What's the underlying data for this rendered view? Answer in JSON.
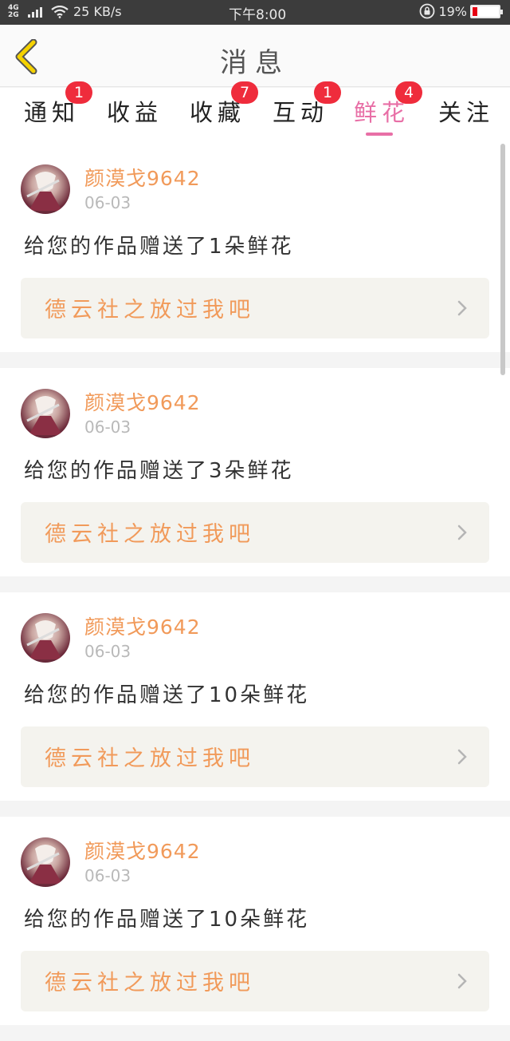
{
  "status_bar": {
    "network": "4G",
    "network2": "2G",
    "speed": "25 KB/s",
    "time": "下午8:00",
    "battery": "19%",
    "battery_color": "#e60012"
  },
  "nav": {
    "back_icon": "chevron-left-icon",
    "title": "消息"
  },
  "tabs": [
    {
      "label": "通知",
      "badge": "1"
    },
    {
      "label": "收益",
      "badge": ""
    },
    {
      "label": "收藏",
      "badge": "7"
    },
    {
      "label": "互动",
      "badge": "1"
    },
    {
      "label": "鲜花",
      "badge": "4"
    },
    {
      "label": "关注",
      "badge": ""
    }
  ],
  "active_tab": "鲜花",
  "colors": {
    "accent": "#e86fa6",
    "username": "#f19a5a",
    "badge": "#ef2c3c"
  },
  "messages": [
    {
      "user": "颜漠戈9642",
      "date": "06-03",
      "text": "给您的作品赠送了1朵鲜花",
      "work": "德云社之放过我吧"
    },
    {
      "user": "颜漠戈9642",
      "date": "06-03",
      "text": "给您的作品赠送了3朵鲜花",
      "work": "德云社之放过我吧"
    },
    {
      "user": "颜漠戈9642",
      "date": "06-03",
      "text": "给您的作品赠送了10朵鲜花",
      "work": "德云社之放过我吧"
    },
    {
      "user": "颜漠戈9642",
      "date": "06-03",
      "text": "给您的作品赠送了10朵鲜花",
      "work": "德云社之放过我吧"
    }
  ]
}
